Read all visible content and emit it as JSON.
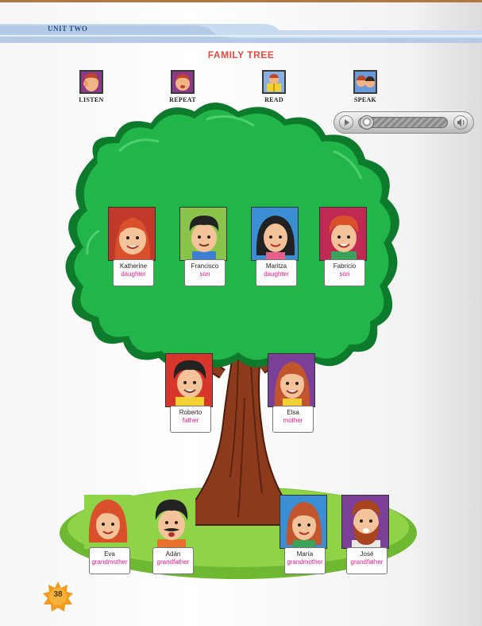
{
  "header": {
    "unit": "UNIT TWO",
    "title": "FAMILY TREE"
  },
  "actions": [
    {
      "label": "LISTEN",
      "icon": "listen-icon"
    },
    {
      "label": "REPEAT",
      "icon": "repeat-icon"
    },
    {
      "label": "READ",
      "icon": "read-icon"
    },
    {
      "label": "SPEAK",
      "icon": "speak-icon"
    }
  ],
  "audio_player": {
    "progress": 0.05,
    "play_icon": "play-icon",
    "volume_icon": "volume-icon"
  },
  "children": [
    {
      "name": "Katherine",
      "role": "daughter"
    },
    {
      "name": "Francisco",
      "role": "son"
    },
    {
      "name": "Maritza",
      "role": "daughter"
    },
    {
      "name": "Fabricio",
      "role": "son"
    }
  ],
  "parents": [
    {
      "name": "Roberto",
      "role": "father"
    },
    {
      "name": "Elsa",
      "role": "mother"
    }
  ],
  "grandparents": [
    {
      "name": "Eva",
      "role": "grandmother"
    },
    {
      "name": "Adán",
      "role": "grandfather"
    },
    {
      "name": "María",
      "role": "grandmother"
    },
    {
      "name": "José",
      "role": "grandfather"
    }
  ],
  "page_number": "38",
  "colors": {
    "tree": "#1fb84a",
    "trunk": "#8b3a1c",
    "grass": "#7ec63a",
    "role_text": "#e8178c",
    "title": "#e8483c"
  }
}
